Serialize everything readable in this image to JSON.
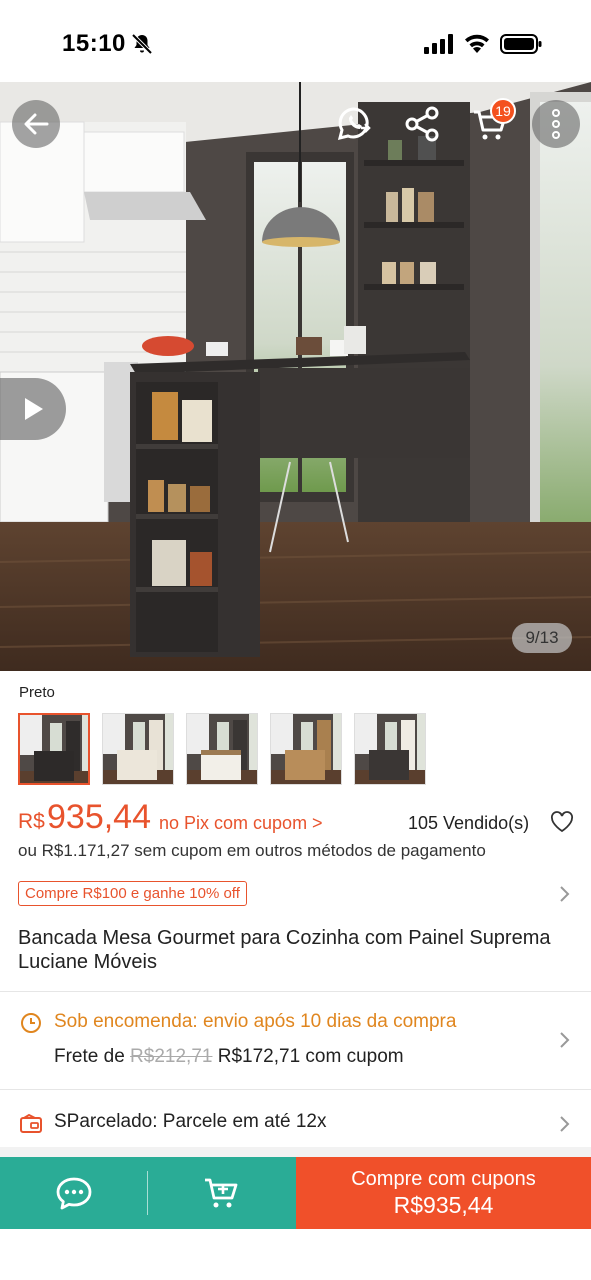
{
  "status": {
    "time": "15:10"
  },
  "hero": {
    "cart_count": "19",
    "counter": "9/13",
    "icons": [
      "back-arrow-icon",
      "whatsapp-share-icon",
      "share-icon",
      "cart-icon",
      "more-vertical-icon",
      "play-icon"
    ]
  },
  "variant": {
    "label": "Preto",
    "thumb_count": 5,
    "selected_index": 0
  },
  "price": {
    "currency": "R$",
    "value": "935,44",
    "pix_note": "no Pix com cupom >",
    "sold": "105 Vendido(s)",
    "alt": "ou R$1.171,27 sem cupom em outros métodos de pagamento"
  },
  "coupon": {
    "text": "Compre R$100 e ganhe 10% off"
  },
  "product": {
    "title": "Bancada Mesa Gourmet para Cozinha com Painel Suprema Luciane Móveis"
  },
  "shipping": {
    "title": "Sob encomenda: envio após 10 dias da compra",
    "frete_label": "Frete de",
    "old_price": "R$212,71",
    "new_price": "R$172,71 com cupom"
  },
  "installments": {
    "text": "SParcelado: Parcele em até 12x"
  },
  "bottom_bar": {
    "buy_label": "Compre com cupons",
    "buy_price": "R$935,44"
  },
  "colors": {
    "accent": "#e8532d",
    "teal": "#2aac96",
    "buy": "#f0502a",
    "ship": "#e0861f"
  }
}
